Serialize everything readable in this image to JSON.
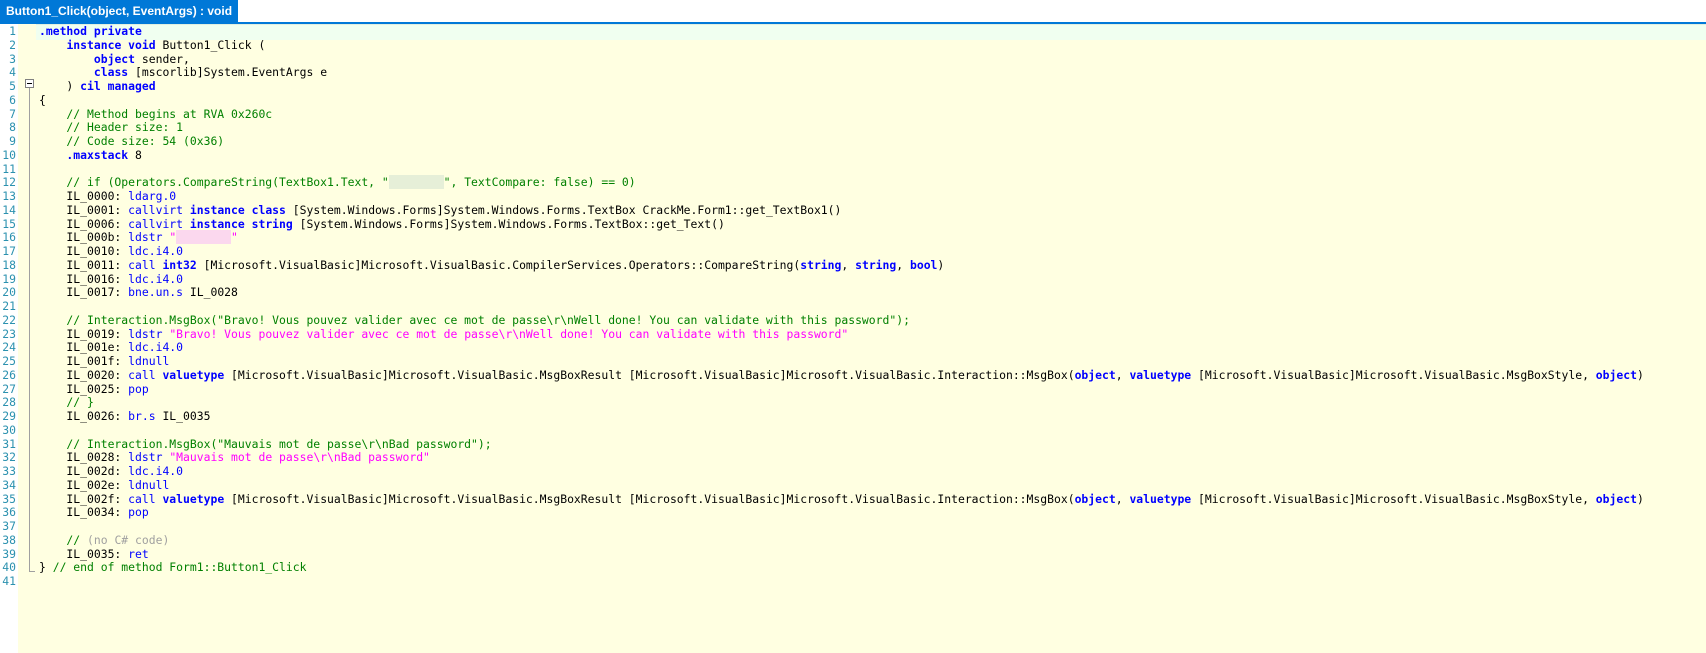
{
  "tab": {
    "title": "Button1_Click(object, EventArgs) : void"
  },
  "lines": [
    {
      "n": "1",
      "parts": [
        [
          "kwb",
          ".method "
        ],
        [
          "kwb",
          "private"
        ]
      ]
    },
    {
      "n": "2",
      "parts": [
        [
          "",
          "    "
        ],
        [
          "kwb",
          "instance "
        ],
        [
          "kwb",
          "void"
        ],
        [
          "",
          " Button1_Click ("
        ]
      ]
    },
    {
      "n": "3",
      "parts": [
        [
          "",
          "        "
        ],
        [
          "kwb",
          "object"
        ],
        [
          "",
          " sender,"
        ]
      ]
    },
    {
      "n": "4",
      "parts": [
        [
          "",
          "        "
        ],
        [
          "kwb",
          "class"
        ],
        [
          "",
          " [mscorlib]System.EventArgs e"
        ]
      ]
    },
    {
      "n": "5",
      "parts": [
        [
          "",
          "    ) "
        ],
        [
          "kwb",
          "cil managed"
        ]
      ]
    },
    {
      "n": "6",
      "parts": [
        [
          "",
          "{"
        ]
      ]
    },
    {
      "n": "7",
      "parts": [
        [
          "cm",
          "    // Method begins at RVA 0x260c"
        ]
      ]
    },
    {
      "n": "8",
      "parts": [
        [
          "cm",
          "    // Header size: 1"
        ]
      ]
    },
    {
      "n": "9",
      "parts": [
        [
          "cm",
          "    // Code size: 54 (0x36)"
        ]
      ]
    },
    {
      "n": "10",
      "parts": [
        [
          "kwb",
          "    .maxstack"
        ],
        [
          "",
          " 8"
        ]
      ]
    },
    {
      "n": "11",
      "parts": []
    },
    {
      "n": "12",
      "parts": [
        [
          "cm",
          "    // if (Operators.CompareString(TextBox1.Text, \""
        ],
        [
          "redact1",
          "        "
        ],
        [
          "cm",
          "\", TextCompare: false) == 0)"
        ]
      ]
    },
    {
      "n": "13",
      "parts": [
        [
          "",
          "    IL_0000: "
        ],
        [
          "op",
          "ldarg.0"
        ]
      ]
    },
    {
      "n": "14",
      "parts": [
        [
          "",
          "    IL_0001: "
        ],
        [
          "op",
          "callvirt "
        ],
        [
          "kwb",
          "instance class"
        ],
        [
          "",
          " [System.Windows.Forms]System.Windows.Forms.TextBox CrackMe.Form1::get_TextBox1()"
        ]
      ]
    },
    {
      "n": "15",
      "parts": [
        [
          "",
          "    IL_0006: "
        ],
        [
          "op",
          "callvirt "
        ],
        [
          "kwb",
          "instance string"
        ],
        [
          "",
          " [System.Windows.Forms]System.Windows.Forms.TextBox::get_Text()"
        ]
      ]
    },
    {
      "n": "16",
      "parts": [
        [
          "",
          "    IL_000b: "
        ],
        [
          "op",
          "ldstr "
        ],
        [
          "str",
          "\""
        ],
        [
          "redact2",
          "        "
        ],
        [
          "str",
          "\""
        ]
      ]
    },
    {
      "n": "17",
      "parts": [
        [
          "",
          "    IL_0010: "
        ],
        [
          "op",
          "ldc.i4.0"
        ]
      ]
    },
    {
      "n": "18",
      "parts": [
        [
          "",
          "    IL_0011: "
        ],
        [
          "op",
          "call "
        ],
        [
          "kwb",
          "int32"
        ],
        [
          "",
          " [Microsoft.VisualBasic]Microsoft.VisualBasic.CompilerServices.Operators::CompareString("
        ],
        [
          "kwb",
          "string"
        ],
        [
          "",
          ", "
        ],
        [
          "kwb",
          "string"
        ],
        [
          "",
          ", "
        ],
        [
          "kwb",
          "bool"
        ],
        [
          "",
          ")"
        ]
      ]
    },
    {
      "n": "19",
      "parts": [
        [
          "",
          "    IL_0016: "
        ],
        [
          "op",
          "ldc.i4.0"
        ]
      ]
    },
    {
      "n": "20",
      "parts": [
        [
          "",
          "    IL_0017: "
        ],
        [
          "op",
          "bne.un.s"
        ],
        [
          "",
          " IL_0028"
        ]
      ]
    },
    {
      "n": "21",
      "parts": []
    },
    {
      "n": "22",
      "parts": [
        [
          "cm",
          "    // Interaction.MsgBox(\"Bravo! Vous pouvez valider avec ce mot de passe\\r\\nWell done! You can validate with this password\");"
        ]
      ]
    },
    {
      "n": "23",
      "parts": [
        [
          "",
          "    IL_0019: "
        ],
        [
          "op",
          "ldstr "
        ],
        [
          "str",
          "\"Bravo! Vous pouvez valider avec ce mot de passe\\r\\nWell done! You can validate with this password\""
        ]
      ]
    },
    {
      "n": "24",
      "parts": [
        [
          "",
          "    IL_001e: "
        ],
        [
          "op",
          "ldc.i4.0"
        ]
      ]
    },
    {
      "n": "25",
      "parts": [
        [
          "",
          "    IL_001f: "
        ],
        [
          "op",
          "ldnull"
        ]
      ]
    },
    {
      "n": "26",
      "parts": [
        [
          "",
          "    IL_0020: "
        ],
        [
          "op",
          "call "
        ],
        [
          "kwb",
          "valuetype"
        ],
        [
          "",
          " [Microsoft.VisualBasic]Microsoft.VisualBasic.MsgBoxResult [Microsoft.VisualBasic]Microsoft.VisualBasic.Interaction::MsgBox("
        ],
        [
          "kwb",
          "object"
        ],
        [
          "",
          ", "
        ],
        [
          "kwb",
          "valuetype"
        ],
        [
          "",
          " [Microsoft.VisualBasic]Microsoft.VisualBasic.MsgBoxStyle, "
        ],
        [
          "kwb",
          "object"
        ],
        [
          "",
          ")"
        ]
      ]
    },
    {
      "n": "27",
      "parts": [
        [
          "",
          "    IL_0025: "
        ],
        [
          "op",
          "pop"
        ]
      ]
    },
    {
      "n": "28",
      "parts": [
        [
          "cm",
          "    // }"
        ]
      ]
    },
    {
      "n": "29",
      "parts": [
        [
          "",
          "    IL_0026: "
        ],
        [
          "op",
          "br.s"
        ],
        [
          "",
          " IL_0035"
        ]
      ]
    },
    {
      "n": "30",
      "parts": []
    },
    {
      "n": "31",
      "parts": [
        [
          "cm",
          "    // Interaction.MsgBox(\"Mauvais mot de passe\\r\\nBad password\");"
        ]
      ]
    },
    {
      "n": "32",
      "parts": [
        [
          "",
          "    IL_0028: "
        ],
        [
          "op",
          "ldstr "
        ],
        [
          "str",
          "\"Mauvais mot de passe\\r\\nBad password\""
        ]
      ]
    },
    {
      "n": "33",
      "parts": [
        [
          "",
          "    IL_002d: "
        ],
        [
          "op",
          "ldc.i4.0"
        ]
      ]
    },
    {
      "n": "34",
      "parts": [
        [
          "",
          "    IL_002e: "
        ],
        [
          "op",
          "ldnull"
        ]
      ]
    },
    {
      "n": "35",
      "parts": [
        [
          "",
          "    IL_002f: "
        ],
        [
          "op",
          "call "
        ],
        [
          "kwb",
          "valuetype"
        ],
        [
          "",
          " [Microsoft.VisualBasic]Microsoft.VisualBasic.MsgBoxResult [Microsoft.VisualBasic]Microsoft.VisualBasic.Interaction::MsgBox("
        ],
        [
          "kwb",
          "object"
        ],
        [
          "",
          ", "
        ],
        [
          "kwb",
          "valuetype"
        ],
        [
          "",
          " [Microsoft.VisualBasic]Microsoft.VisualBasic.MsgBoxStyle, "
        ],
        [
          "kwb",
          "object"
        ],
        [
          "",
          ")"
        ]
      ]
    },
    {
      "n": "36",
      "parts": [
        [
          "",
          "    IL_0034: "
        ],
        [
          "op",
          "pop"
        ]
      ]
    },
    {
      "n": "37",
      "parts": []
    },
    {
      "n": "38",
      "parts": [
        [
          "cm",
          "    // "
        ],
        [
          "gray",
          "(no C# code)"
        ]
      ]
    },
    {
      "n": "39",
      "parts": [
        [
          "",
          "    IL_0035: "
        ],
        [
          "op",
          "ret"
        ]
      ]
    },
    {
      "n": "40",
      "parts": [
        [
          "",
          "} "
        ],
        [
          "cm",
          "// end of method Form1::Button1_Click"
        ]
      ]
    },
    {
      "n": "41",
      "parts": []
    }
  ],
  "colors": {
    "tab_bg": "#0078d7",
    "editor_bg": "#ffffe1",
    "keyword": "#0000ff",
    "comment": "#008000",
    "string": "#ff00ff",
    "line_number": "#2b91af"
  }
}
